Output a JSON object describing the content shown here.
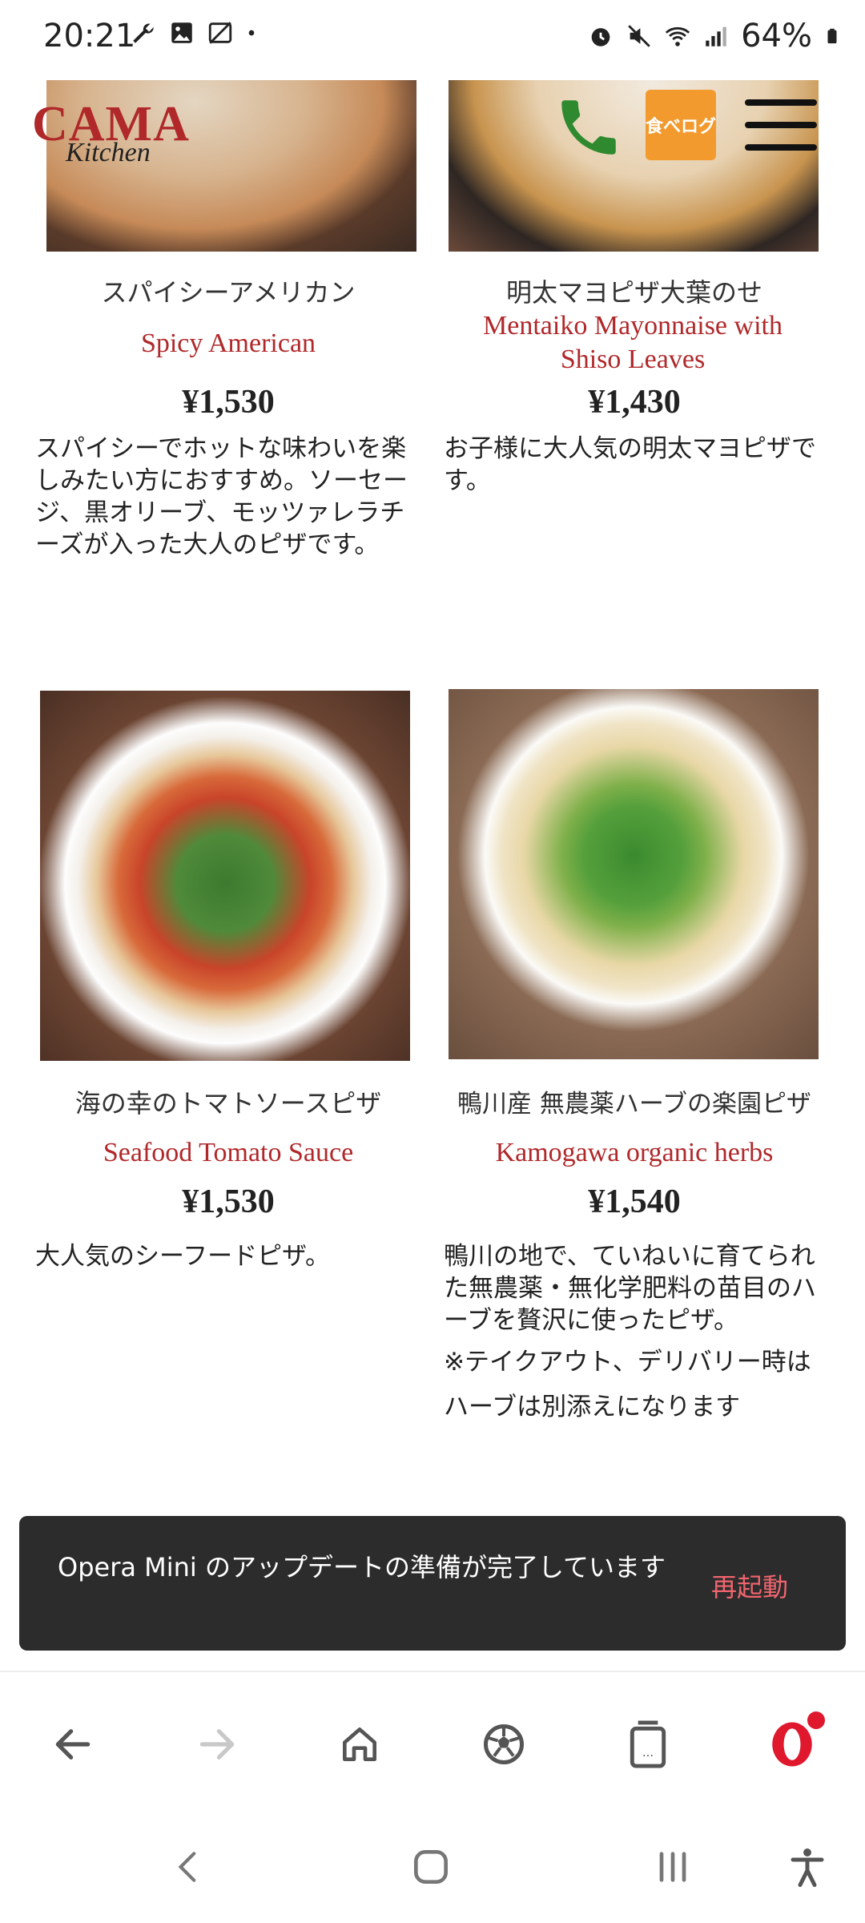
{
  "status_bar": {
    "time": "20:21",
    "battery": "64%",
    "left_icons": [
      "wrench-icon",
      "image-icon",
      "no-photo-icon",
      "dot-icon"
    ],
    "right_icons": [
      "alarm-icon",
      "mute-icon",
      "wifi-icon",
      "signal-icon",
      "battery-icon"
    ]
  },
  "header": {
    "logo_main": "CAMA",
    "logo_sub": "Kitchen",
    "tabelog_label": "食べログ"
  },
  "products": [
    {
      "jp_name": "スパイシーアメリカン",
      "en_name": "Spicy American",
      "price": "¥1,530",
      "description": "スパイシーでホットな味わいを楽しみたい方におすすめ。ソーセージ、黒オリーブ、モッツァレラチーズが入った大人のピザです。"
    },
    {
      "jp_name": "明太マヨピザ大葉のせ",
      "en_name": "Mentaiko Mayonnaise with Shiso Leaves",
      "price": "¥1,430",
      "description": "お子様に大人気の明太マヨピザです。"
    },
    {
      "jp_name": "海の幸のトマトソースピザ",
      "en_name": "Seafood Tomato Sauce",
      "price": "¥1,530",
      "description": "大人気のシーフードピザ。"
    },
    {
      "jp_name": "鴨川産 無農薬ハーブの楽園ピザ",
      "en_name": "Kamogawa organic herbs",
      "price": "¥1,540",
      "description": "鴨川の地で、ていねいに育てられた無農薬・無化学肥料の苗目のハーブを贅沢に使ったピザ。",
      "note": "※テイクアウト、デリバリー時はハーブは別添えになります"
    }
  ],
  "toast": {
    "message": "Opera Mini のアップデートの準備が完了しています",
    "action": "再起動"
  },
  "browser_nav": {
    "icons": [
      "back-arrow-icon",
      "forward-arrow-icon",
      "home-icon",
      "soccer-ball-icon",
      "tabs-icon",
      "opera-logo-icon"
    ],
    "tabs_label": "..."
  },
  "system_nav": {
    "icons": [
      "system-back-icon",
      "system-home-icon",
      "system-recents-icon",
      "accessibility-icon"
    ]
  },
  "colors": {
    "accent_red": "#b0282a",
    "tabelog_orange": "#f29a2e",
    "phone_green": "#2f8a2f",
    "toast_bg": "#2c2c2c",
    "toast_action": "#f0656e"
  }
}
